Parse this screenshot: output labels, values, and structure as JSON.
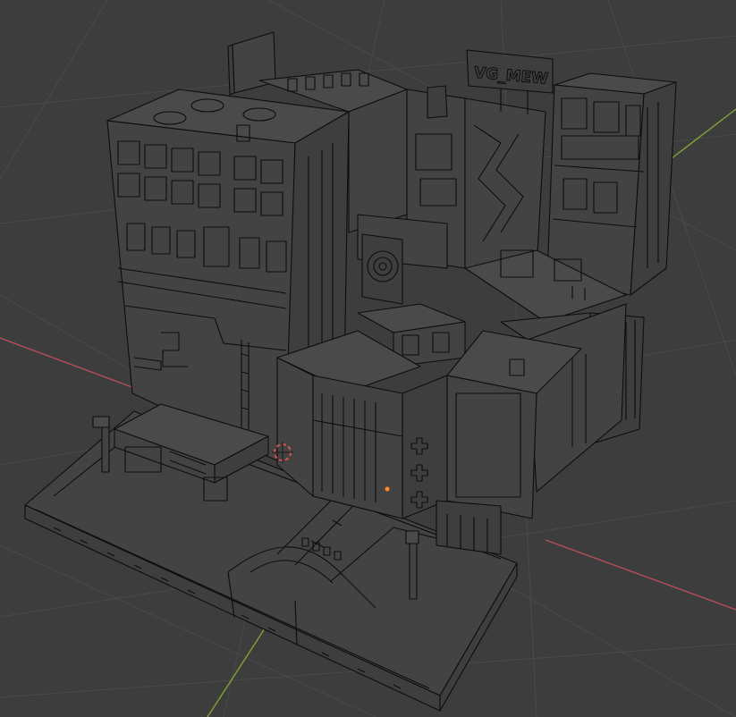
{
  "viewport": {
    "background": "#3d3d3d",
    "grid_color": "#4a4a4a",
    "x_axis_color": "#b34f5a",
    "y_axis_color": "#7ea335",
    "wire_color": "#0d0d0d",
    "origin_dot_color": "#ff8a2a",
    "cursor_color": "#e05050"
  },
  "scene": {
    "billboard_text": "VG_MEW"
  },
  "icons": {
    "cursor": "3d-cursor-icon",
    "origin": "object-origin-icon"
  }
}
